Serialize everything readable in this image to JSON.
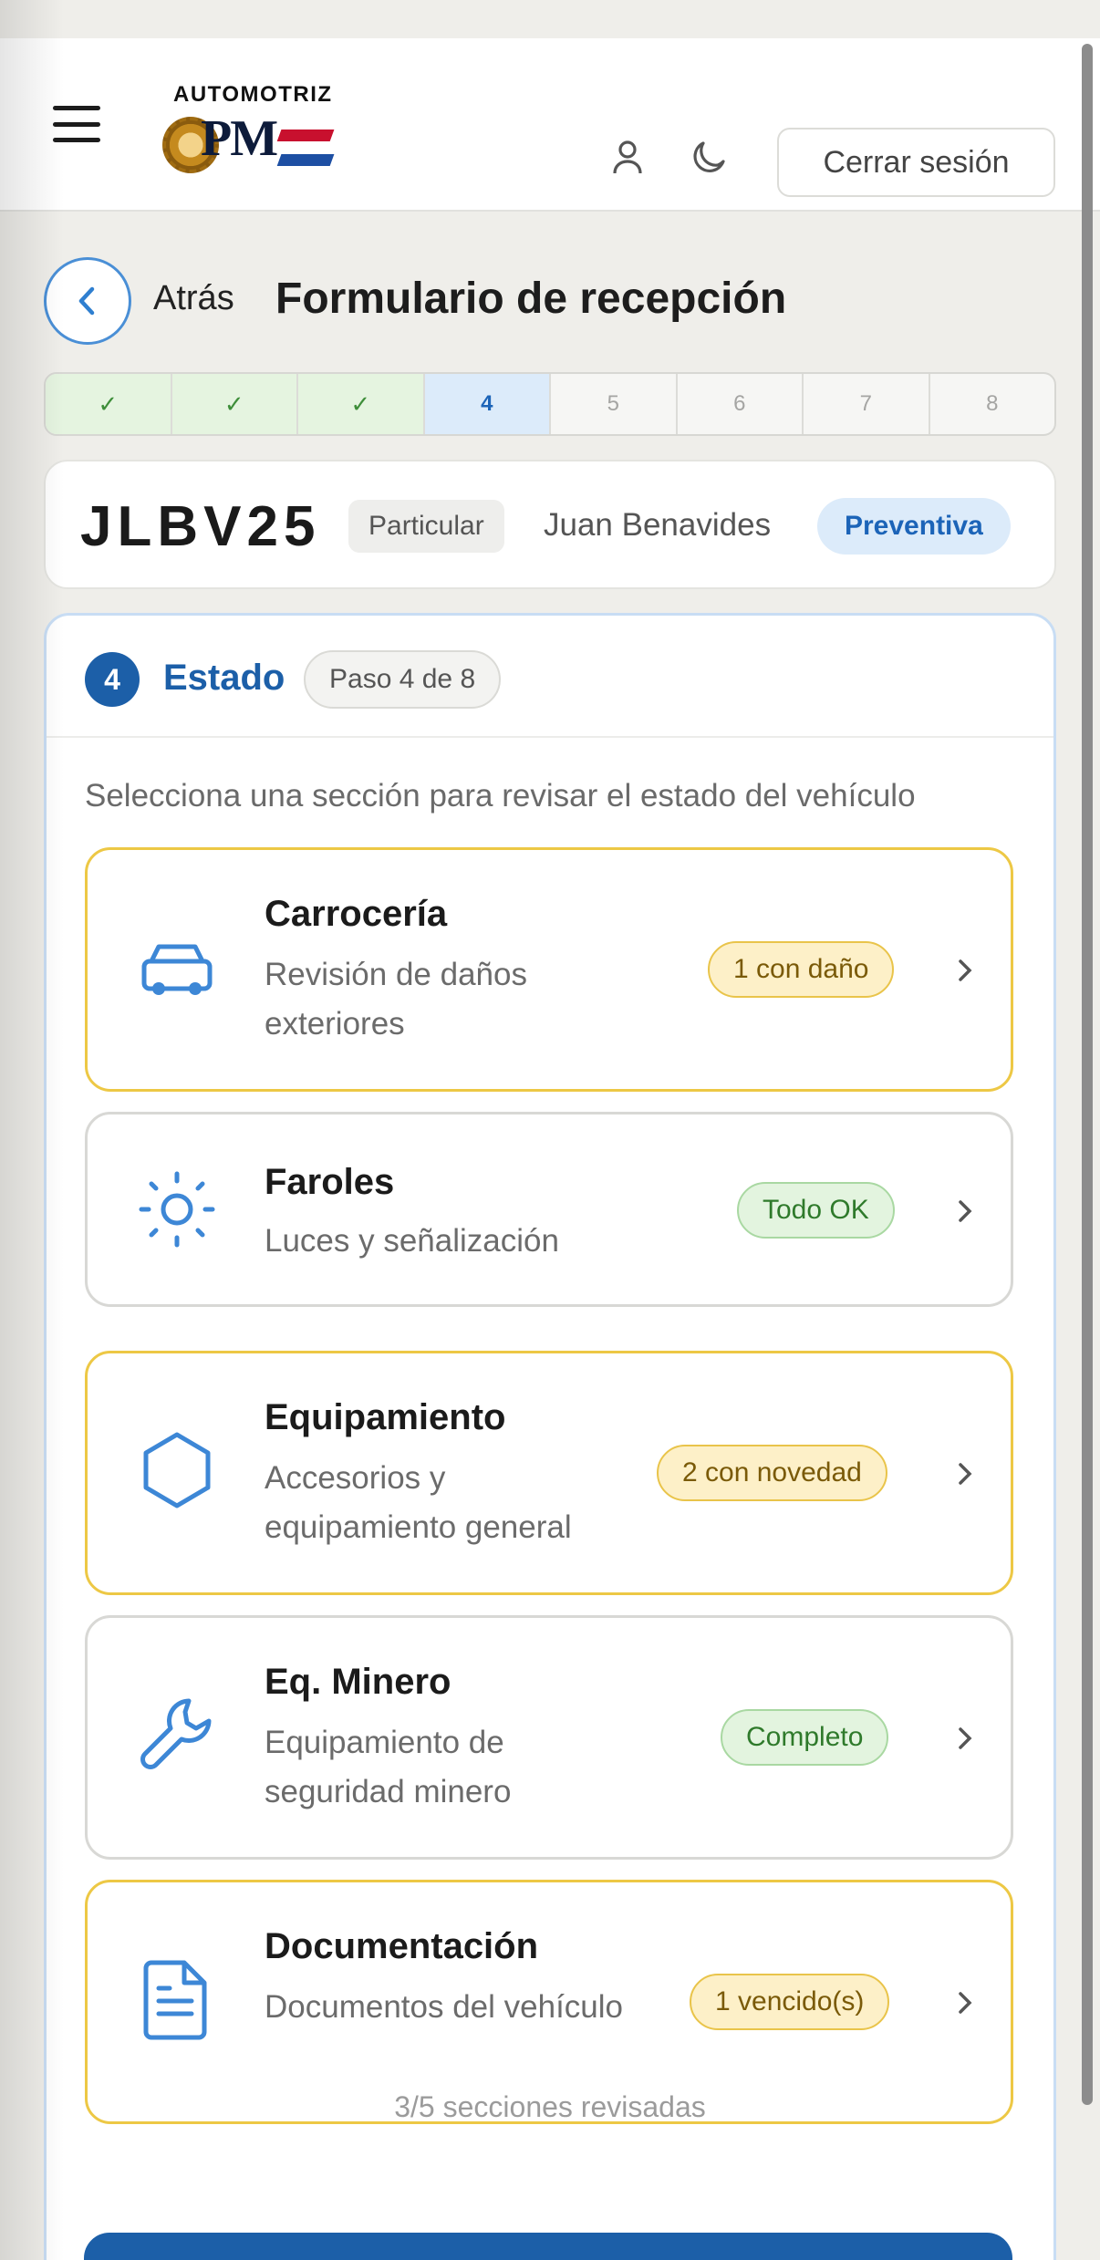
{
  "header": {
    "logo_top": "AUTOMOTRIZ",
    "logo_mark": "PM",
    "logout_label": "Cerrar sesión",
    "icons": [
      "menu-icon",
      "user-icon",
      "moon-icon"
    ]
  },
  "title_row": {
    "back_label": "Atrás",
    "title": "Formulario de recepción"
  },
  "stepper": {
    "steps": [
      "✓",
      "✓",
      "✓",
      "4",
      "5",
      "6",
      "7",
      "8"
    ],
    "current": 4
  },
  "vehicle": {
    "plate": "JLBV25",
    "type": "Particular",
    "owner": "Juan Benavides",
    "service": "Preventiva"
  },
  "section": {
    "number": "4",
    "title": "Estado",
    "step_badge": "Paso 4 de 8",
    "description": "Selecciona una sección para revisar el estado del vehículo"
  },
  "items": [
    {
      "title": "Carrocería",
      "subtitle": "Revisión de daños exteriores",
      "badge": "1 con daño",
      "status": "warn",
      "icon": "car-icon"
    },
    {
      "title": "Faroles",
      "subtitle": "Luces y señalización",
      "badge": "Todo OK",
      "status": "ok",
      "icon": "sun-icon"
    },
    {
      "title": "Equipamiento",
      "subtitle": "Accesorios y equipamiento general",
      "badge": "2 con novedad",
      "status": "warn",
      "icon": "hexagon-icon"
    },
    {
      "title": "Eq. Minero",
      "subtitle": "Equipamiento de seguridad minero",
      "badge": "Completo",
      "status": "ok",
      "icon": "wrench-icon"
    },
    {
      "title": "Documentación",
      "subtitle": "Documentos del vehículo",
      "badge": "1 vencido(s)",
      "status": "warn",
      "icon": "document-icon"
    }
  ],
  "progress_text": "3/5 secciones revisadas",
  "colors": {
    "primary": "#1c5fa8",
    "accent_light": "#dcebfa",
    "warn_border": "#edc845",
    "ok_bg": "#e3f4df"
  }
}
